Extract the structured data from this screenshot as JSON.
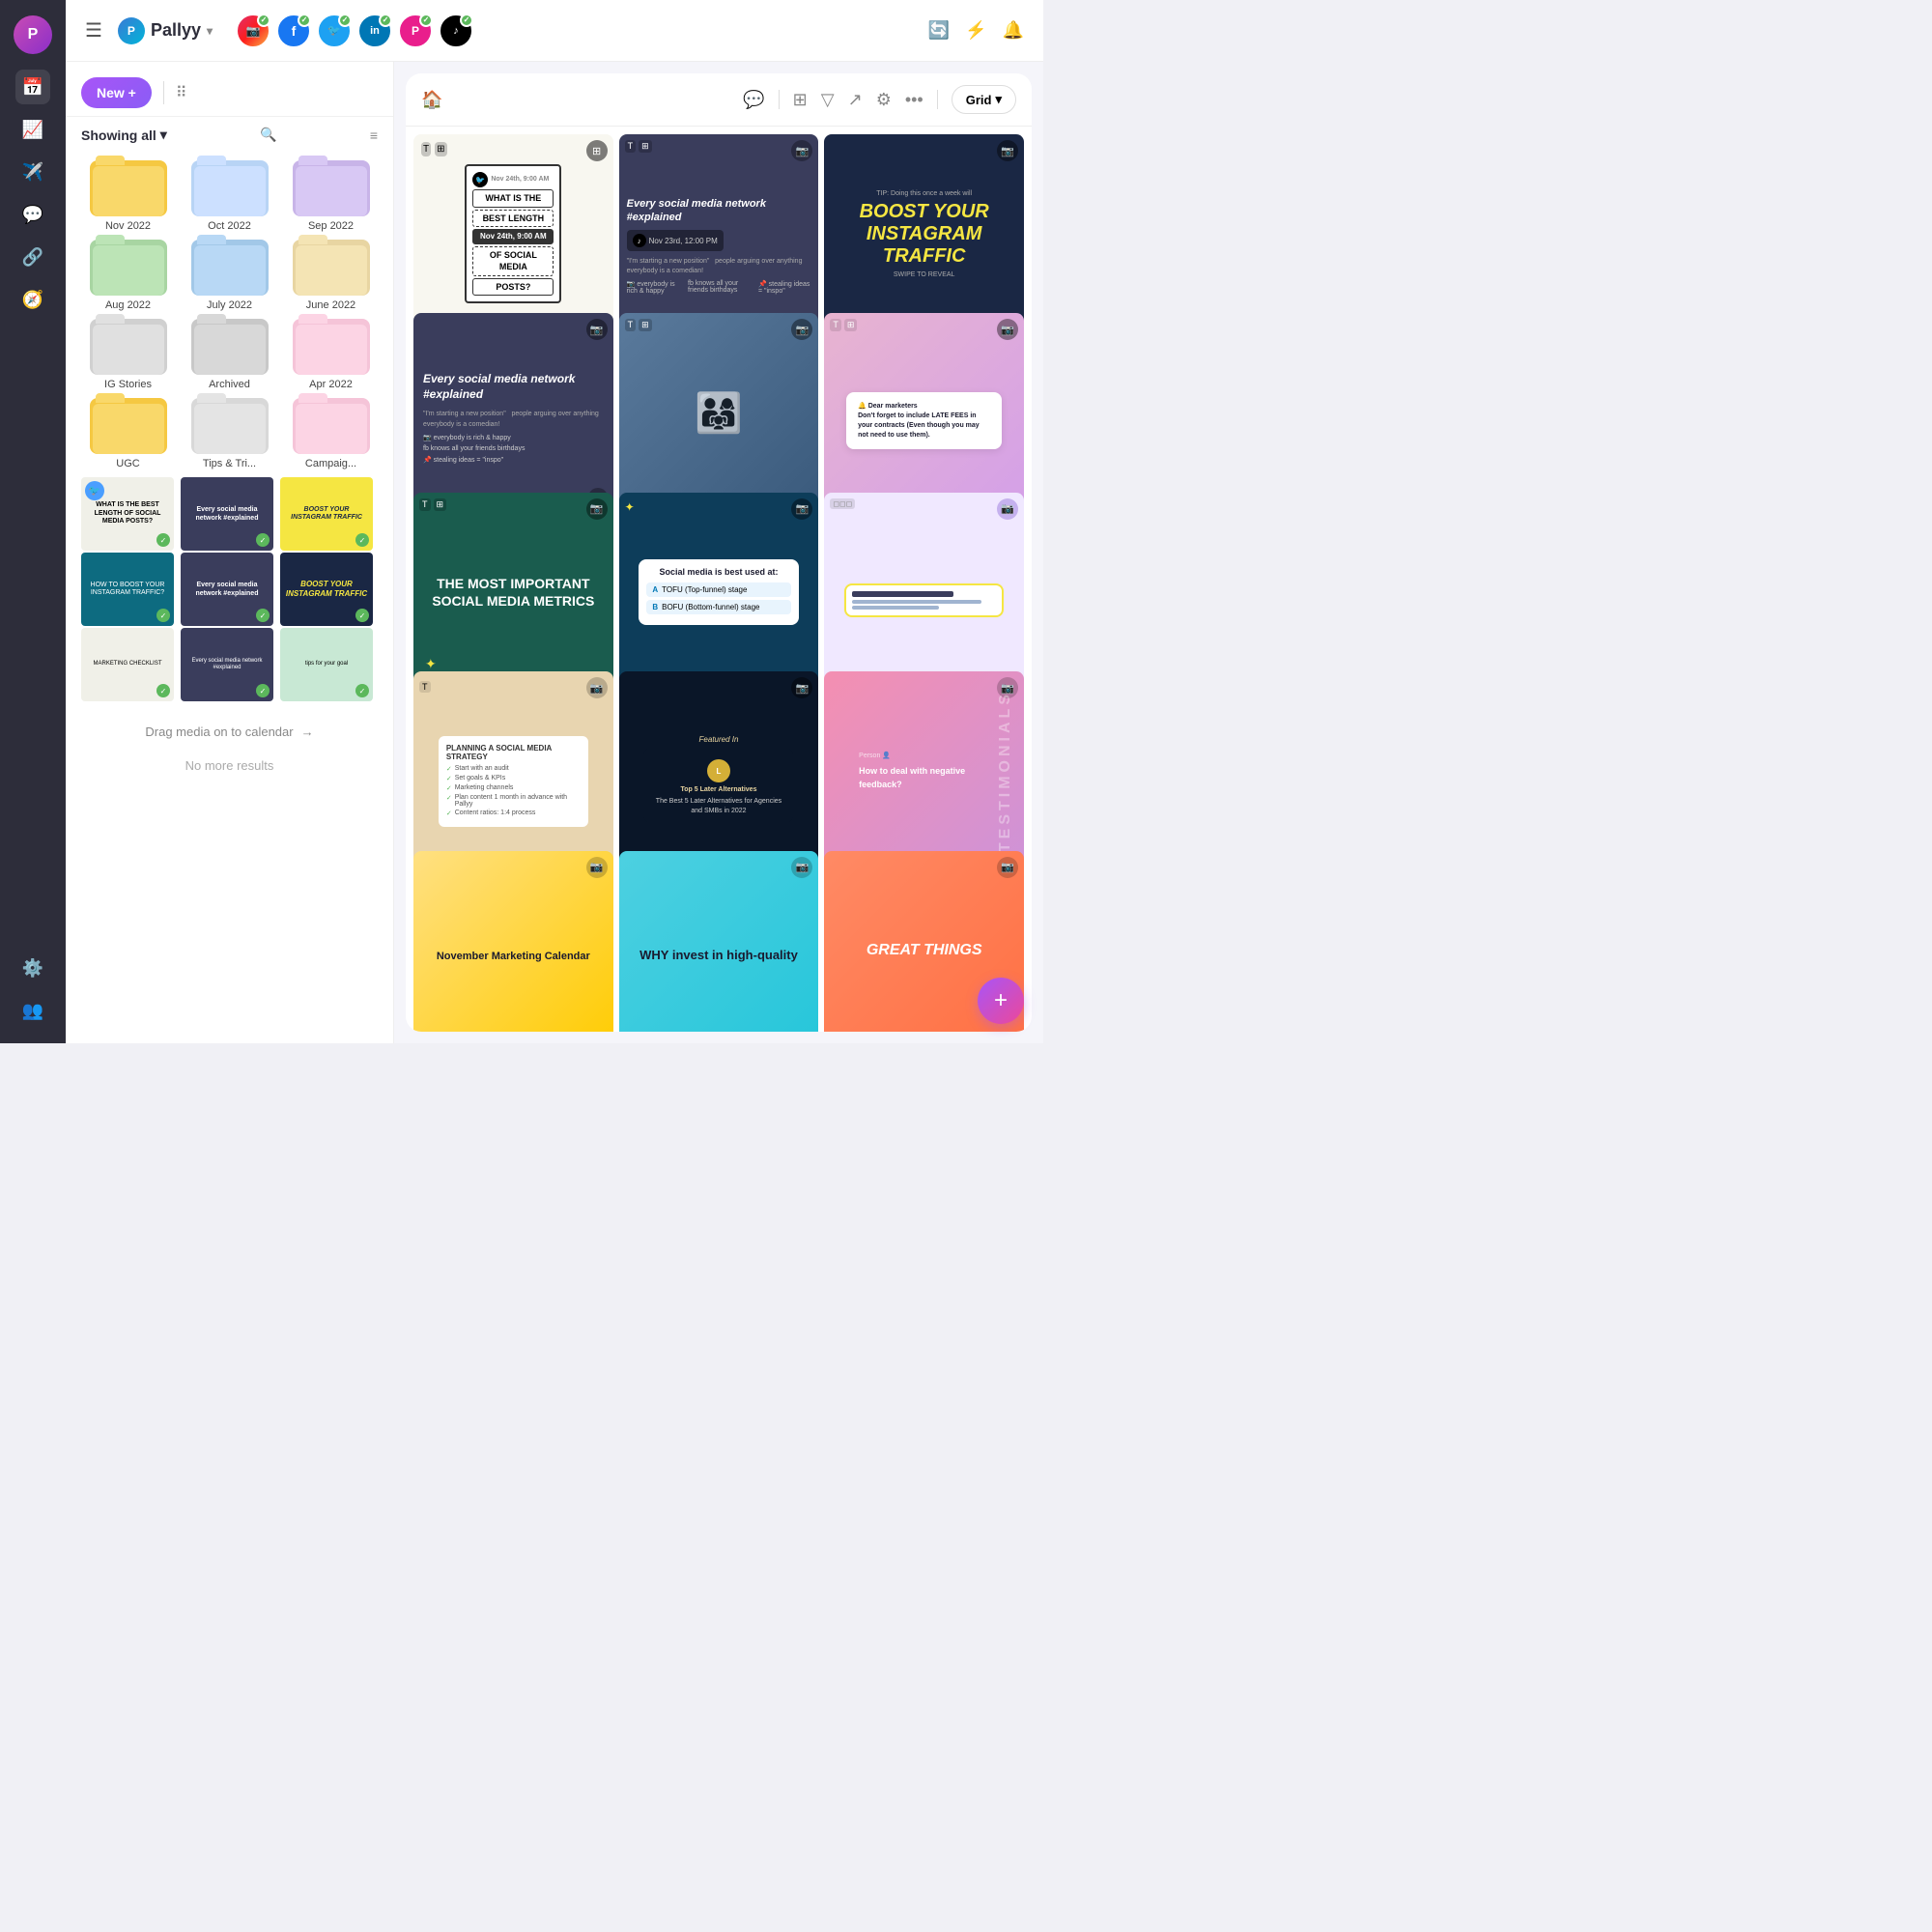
{
  "app": {
    "name": "Pallyy",
    "avatar_letter": "P"
  },
  "topbar": {
    "hamburger": "☰",
    "brand_name": "Pallyy",
    "chevron": "▾",
    "platforms": [
      {
        "id": "instagram",
        "label": "IG",
        "class": "pi-instagram",
        "symbol": "📷"
      },
      {
        "id": "facebook",
        "label": "FB",
        "class": "pi-facebook",
        "symbol": "f"
      },
      {
        "id": "twitter",
        "label": "TW",
        "class": "pi-twitter",
        "symbol": "🐦"
      },
      {
        "id": "linkedin",
        "label": "in",
        "class": "pi-linkedin",
        "symbol": "in"
      },
      {
        "id": "extra",
        "label": "P+",
        "class": "pi-extra",
        "symbol": "P"
      },
      {
        "id": "pinterest",
        "label": "PI",
        "class": "pi-pinterest",
        "symbol": "P"
      },
      {
        "id": "tiktok",
        "label": "TK",
        "class": "pi-tiktok",
        "symbol": "♪"
      }
    ],
    "icons": [
      "🔄",
      "⚡",
      "🔔"
    ]
  },
  "sidebar": {
    "new_btn_label": "New +",
    "filter_label": "Showing all",
    "filter_chevron": "▾",
    "folders": [
      {
        "label": "Nov 2022",
        "color": "#f5c842"
      },
      {
        "label": "Oct 2022",
        "color": "#b8d4f5"
      },
      {
        "label": "Sep 2022",
        "color": "#c8b4e8"
      },
      {
        "label": "Aug 2022",
        "color": "#a8d5a2"
      },
      {
        "label": "July 2022",
        "color": "#a2c8e8"
      },
      {
        "label": "June 2022",
        "color": "#e8d5a2"
      },
      {
        "label": "IG Stories",
        "color": "#d4d4d4"
      },
      {
        "label": "Archived",
        "color": "#d4d4d4"
      },
      {
        "label": "Apr 2022",
        "color": "#f5c4d8"
      },
      {
        "label": "UGC",
        "color": "#f5c842"
      },
      {
        "label": "Tips & Tri...",
        "color": "#d4d4d4"
      },
      {
        "label": "Campaig...",
        "color": "#f5c4d8"
      }
    ],
    "drag_hint": "Drag media on to calendar",
    "no_results": "No more results"
  },
  "grid": {
    "view_label": "Grid",
    "chevron": "▾",
    "cells": [
      {
        "id": 1,
        "type": "sketch",
        "platform": "tiktok"
      },
      {
        "id": 2,
        "type": "network-explained",
        "platform": "instagram"
      },
      {
        "id": 3,
        "type": "boost-instagram",
        "platform": "instagram"
      },
      {
        "id": 4,
        "type": "network-explained-2",
        "platform": "instagram"
      },
      {
        "id": 5,
        "type": "people-photo",
        "platform": "instagram"
      },
      {
        "id": 6,
        "type": "dear-marketers",
        "platform": "instagram"
      },
      {
        "id": 7,
        "type": "metrics",
        "platform": "instagram"
      },
      {
        "id": 8,
        "type": "quiz-social",
        "platform": "instagram"
      },
      {
        "id": 9,
        "type": "screen-mockup",
        "platform": "instagram"
      },
      {
        "id": 10,
        "type": "planning",
        "platform": "instagram"
      },
      {
        "id": 11,
        "type": "later-alternatives",
        "platform": "instagram"
      },
      {
        "id": 12,
        "type": "testimonials",
        "platform": "instagram"
      },
      {
        "id": 13,
        "type": "calendar",
        "platform": "instagram"
      },
      {
        "id": 14,
        "type": "invest",
        "platform": "instagram"
      },
      {
        "id": 15,
        "type": "great",
        "platform": "instagram"
      }
    ]
  },
  "fab": {
    "label": "+"
  }
}
